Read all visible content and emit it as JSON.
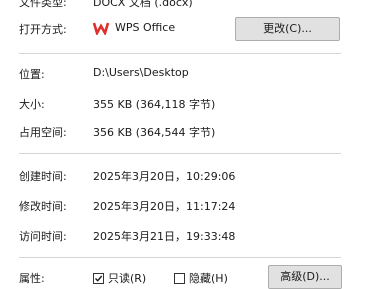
{
  "file_type": {
    "label": "文件类型:",
    "value": "DOCX 文档 (.docx)"
  },
  "open_with": {
    "label": "打开方式:",
    "app_name": "WPS Office",
    "change_button": "更改(C)..."
  },
  "location": {
    "label": "位置:",
    "value": "D:\\Users\\Desktop"
  },
  "size": {
    "label": "大小:",
    "value": "355 KB (364,118 字节)"
  },
  "size_on_disk": {
    "label": "占用空间:",
    "value": "356 KB (364,544 字节)"
  },
  "created": {
    "label": "创建时间:",
    "value": "2025年3月20日，10:29:06"
  },
  "modified": {
    "label": "修改时间:",
    "value": "2025年3月20日，11:17:24"
  },
  "accessed": {
    "label": "访问时间:",
    "value": "2025年3月21日，19:33:48"
  },
  "attributes": {
    "label": "属性:",
    "readonly_label": "只读(R)",
    "readonly_checked": true,
    "hidden_label": "隐藏(H)",
    "hidden_checked": false,
    "advanced_button": "高级(D)..."
  },
  "colors": {
    "wps_red": "#e0302b",
    "button_bg": "#e1e1e1",
    "separator": "#d6d6d6"
  }
}
